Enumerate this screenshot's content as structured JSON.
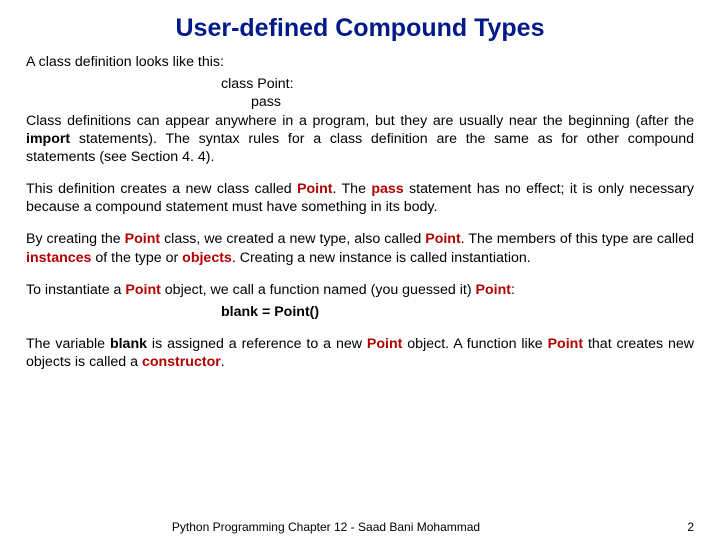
{
  "title": "User-defined Compound Types",
  "p1_lead": "A class definition looks like this:",
  "code1": "class Point:",
  "code2": "pass",
  "p1_rest_a": "Class definitions can appear anywhere in a program, but they are usually near the beginning (after the ",
  "p1_import": "import",
  "p1_rest_b": " statements). The syntax rules for a class definition are the same as for other compound statements (see Section 4. 4).",
  "p2_a": "This definition creates a new class called ",
  "p2_point": "Point",
  "p2_b": ". The ",
  "p2_pass": "pass",
  "p2_c": " statement has no effect; it is only necessary because a compound statement must have something in its body.",
  "p3_a": "By creating the ",
  "p3_point1": "Point",
  "p3_b": " class, we created a new type, also called ",
  "p3_point2": "Point",
  "p3_c": ". The members of this type are called ",
  "p3_instances": "instances",
  "p3_d": " of the type or ",
  "p3_objects": "objects",
  "p3_e": ". Creating a new instance is called instantiation.",
  "p4_a": "To instantiate a ",
  "p4_point1": "Point",
  "p4_b": " object, we call a function named (you guessed it) ",
  "p4_point2": "Point",
  "p4_c": ":",
  "code3": "blank = Point()",
  "p5_a": "The variable ",
  "p5_blank": "blank",
  "p5_b": " is assigned a reference to a new ",
  "p5_point1": "Point",
  "p5_c": " object. A function like ",
  "p5_point2": "Point",
  "p5_d": " that creates new objects is called a ",
  "p5_constructor": "constructor",
  "p5_e": ".",
  "footer": "Python Programming Chapter 12 - Saad Bani Mohammad",
  "page": "2"
}
